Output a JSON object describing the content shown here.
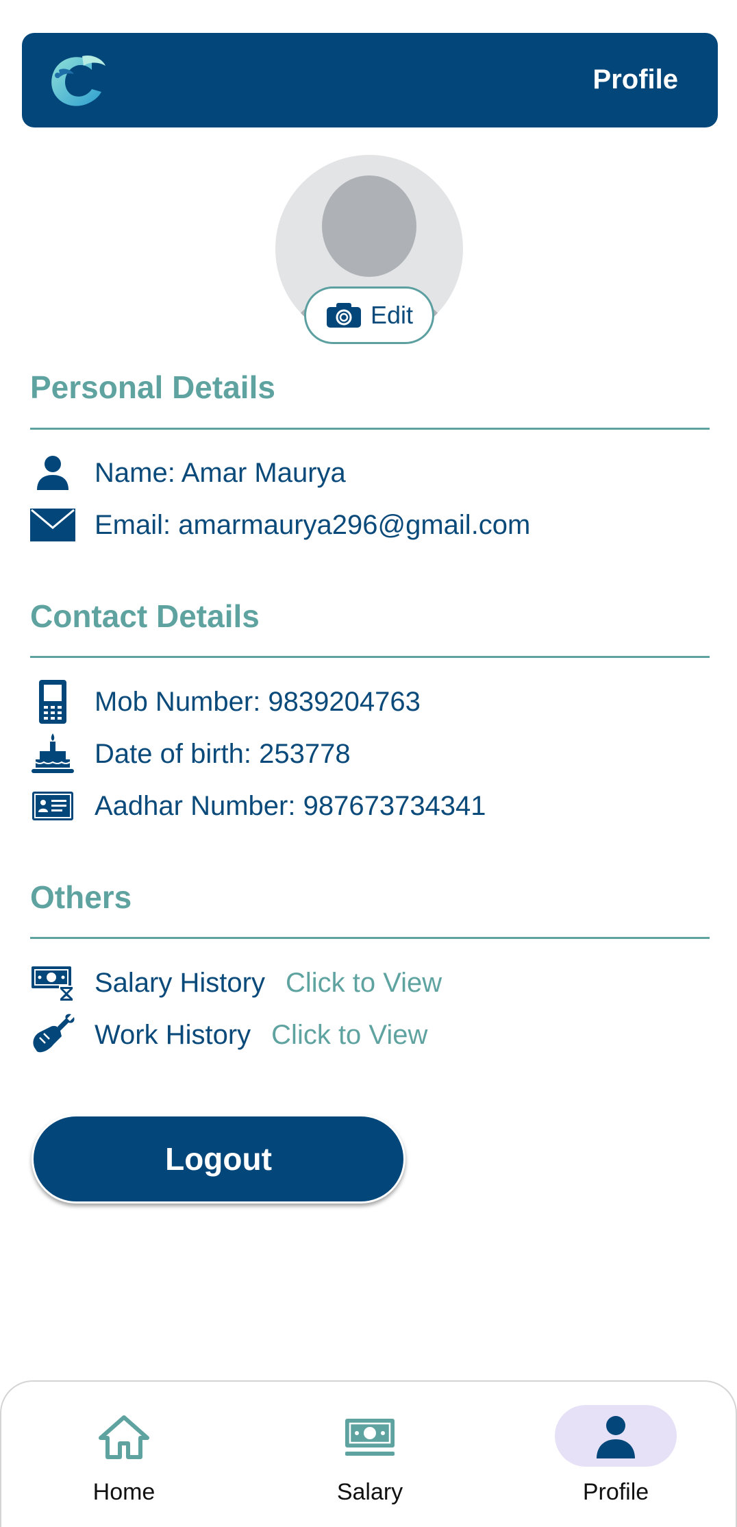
{
  "header": {
    "title": "Profile"
  },
  "avatar": {
    "edit_label": "Edit"
  },
  "personal": {
    "title": "Personal Details",
    "name": "Name: Amar Maurya",
    "email": "Email: amarmaurya296@gmail.com"
  },
  "contact": {
    "title": "Contact Details",
    "mobile": "Mob Number: 9839204763",
    "dob": "Date of birth: 253778",
    "aadhar": "Aadhar Number: 987673734341"
  },
  "others": {
    "title": "Others",
    "salary_label": "Salary History",
    "salary_link": "Click to View",
    "work_label": "Work History",
    "work_link": "Click to View"
  },
  "logout_label": "Logout",
  "nav": {
    "items": [
      {
        "label": "Home",
        "icon": "home-icon"
      },
      {
        "label": "Salary",
        "icon": "money-icon"
      },
      {
        "label": "Profile",
        "icon": "person-icon",
        "active": true
      }
    ]
  },
  "colors": {
    "primary": "#03467a",
    "accent": "#5fa3a0",
    "nav_active": "#e6e1f6"
  }
}
